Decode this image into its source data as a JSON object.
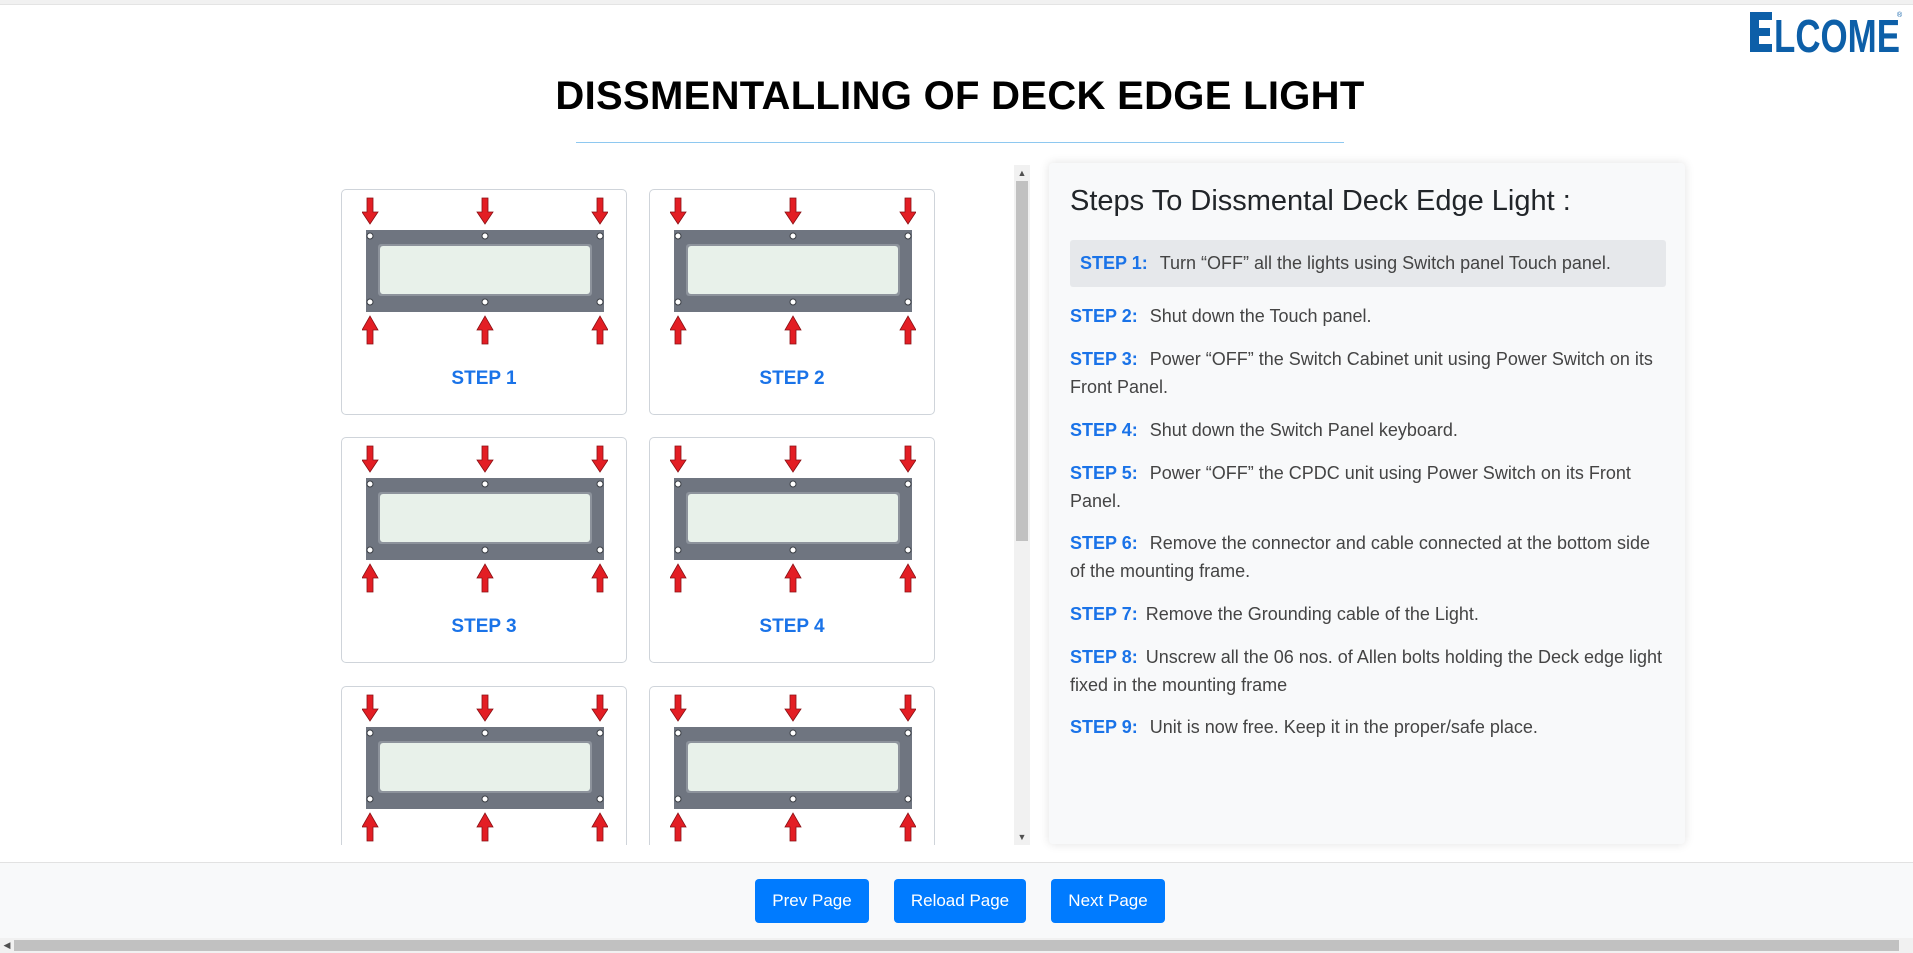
{
  "brand": {
    "logo_text": "ELCOME",
    "logo_mark": "®"
  },
  "header": {
    "title": "DISSMENTALLING OF DECK EDGE LIGHT"
  },
  "gallery": {
    "items": [
      {
        "label": "STEP 1"
      },
      {
        "label": "STEP 2"
      },
      {
        "label": "STEP 3"
      },
      {
        "label": "STEP 4"
      },
      {
        "label": ""
      },
      {
        "label": ""
      }
    ]
  },
  "steps": {
    "heading": "Steps To Dissmental Deck Edge Light :",
    "items": [
      {
        "label": "STEP 1:",
        "text": "Turn “OFF” all the lights using Switch panel Touch panel."
      },
      {
        "label": "STEP 2:",
        "text": "Shut down the Touch panel."
      },
      {
        "label": "STEP 3:",
        "text": "Power “OFF” the Switch Cabinet unit using Power Switch on its Front Panel."
      },
      {
        "label": "STEP 4:",
        "text": "Shut down the Switch Panel keyboard."
      },
      {
        "label": "STEP 5:",
        "text": "Power “OFF” the CPDC unit using Power Switch on its Front Panel."
      },
      {
        "label": "STEP 6:",
        "text": "Remove the connector and cable connected at the bottom side of the mounting frame."
      },
      {
        "label": "STEP 7:",
        "text": "Remove the Grounding cable of the Light."
      },
      {
        "label": "STEP 8:",
        "text": "Unscrew all the 06 nos. of Allen bolts holding the Deck edge light fixed in the mounting frame"
      },
      {
        "label": "STEP 9:",
        "text": "Unit is now free. Keep it in the proper/safe place."
      }
    ]
  },
  "footer": {
    "prev_label": "Prev Page",
    "reload_label": "Reload Page",
    "next_label": "Next Page"
  },
  "colors": {
    "accent": "#007bff",
    "step_label": "#1a73e8",
    "logo": "#0d5fa8",
    "arrow": "#e31e24",
    "frame": "#6f7580"
  }
}
